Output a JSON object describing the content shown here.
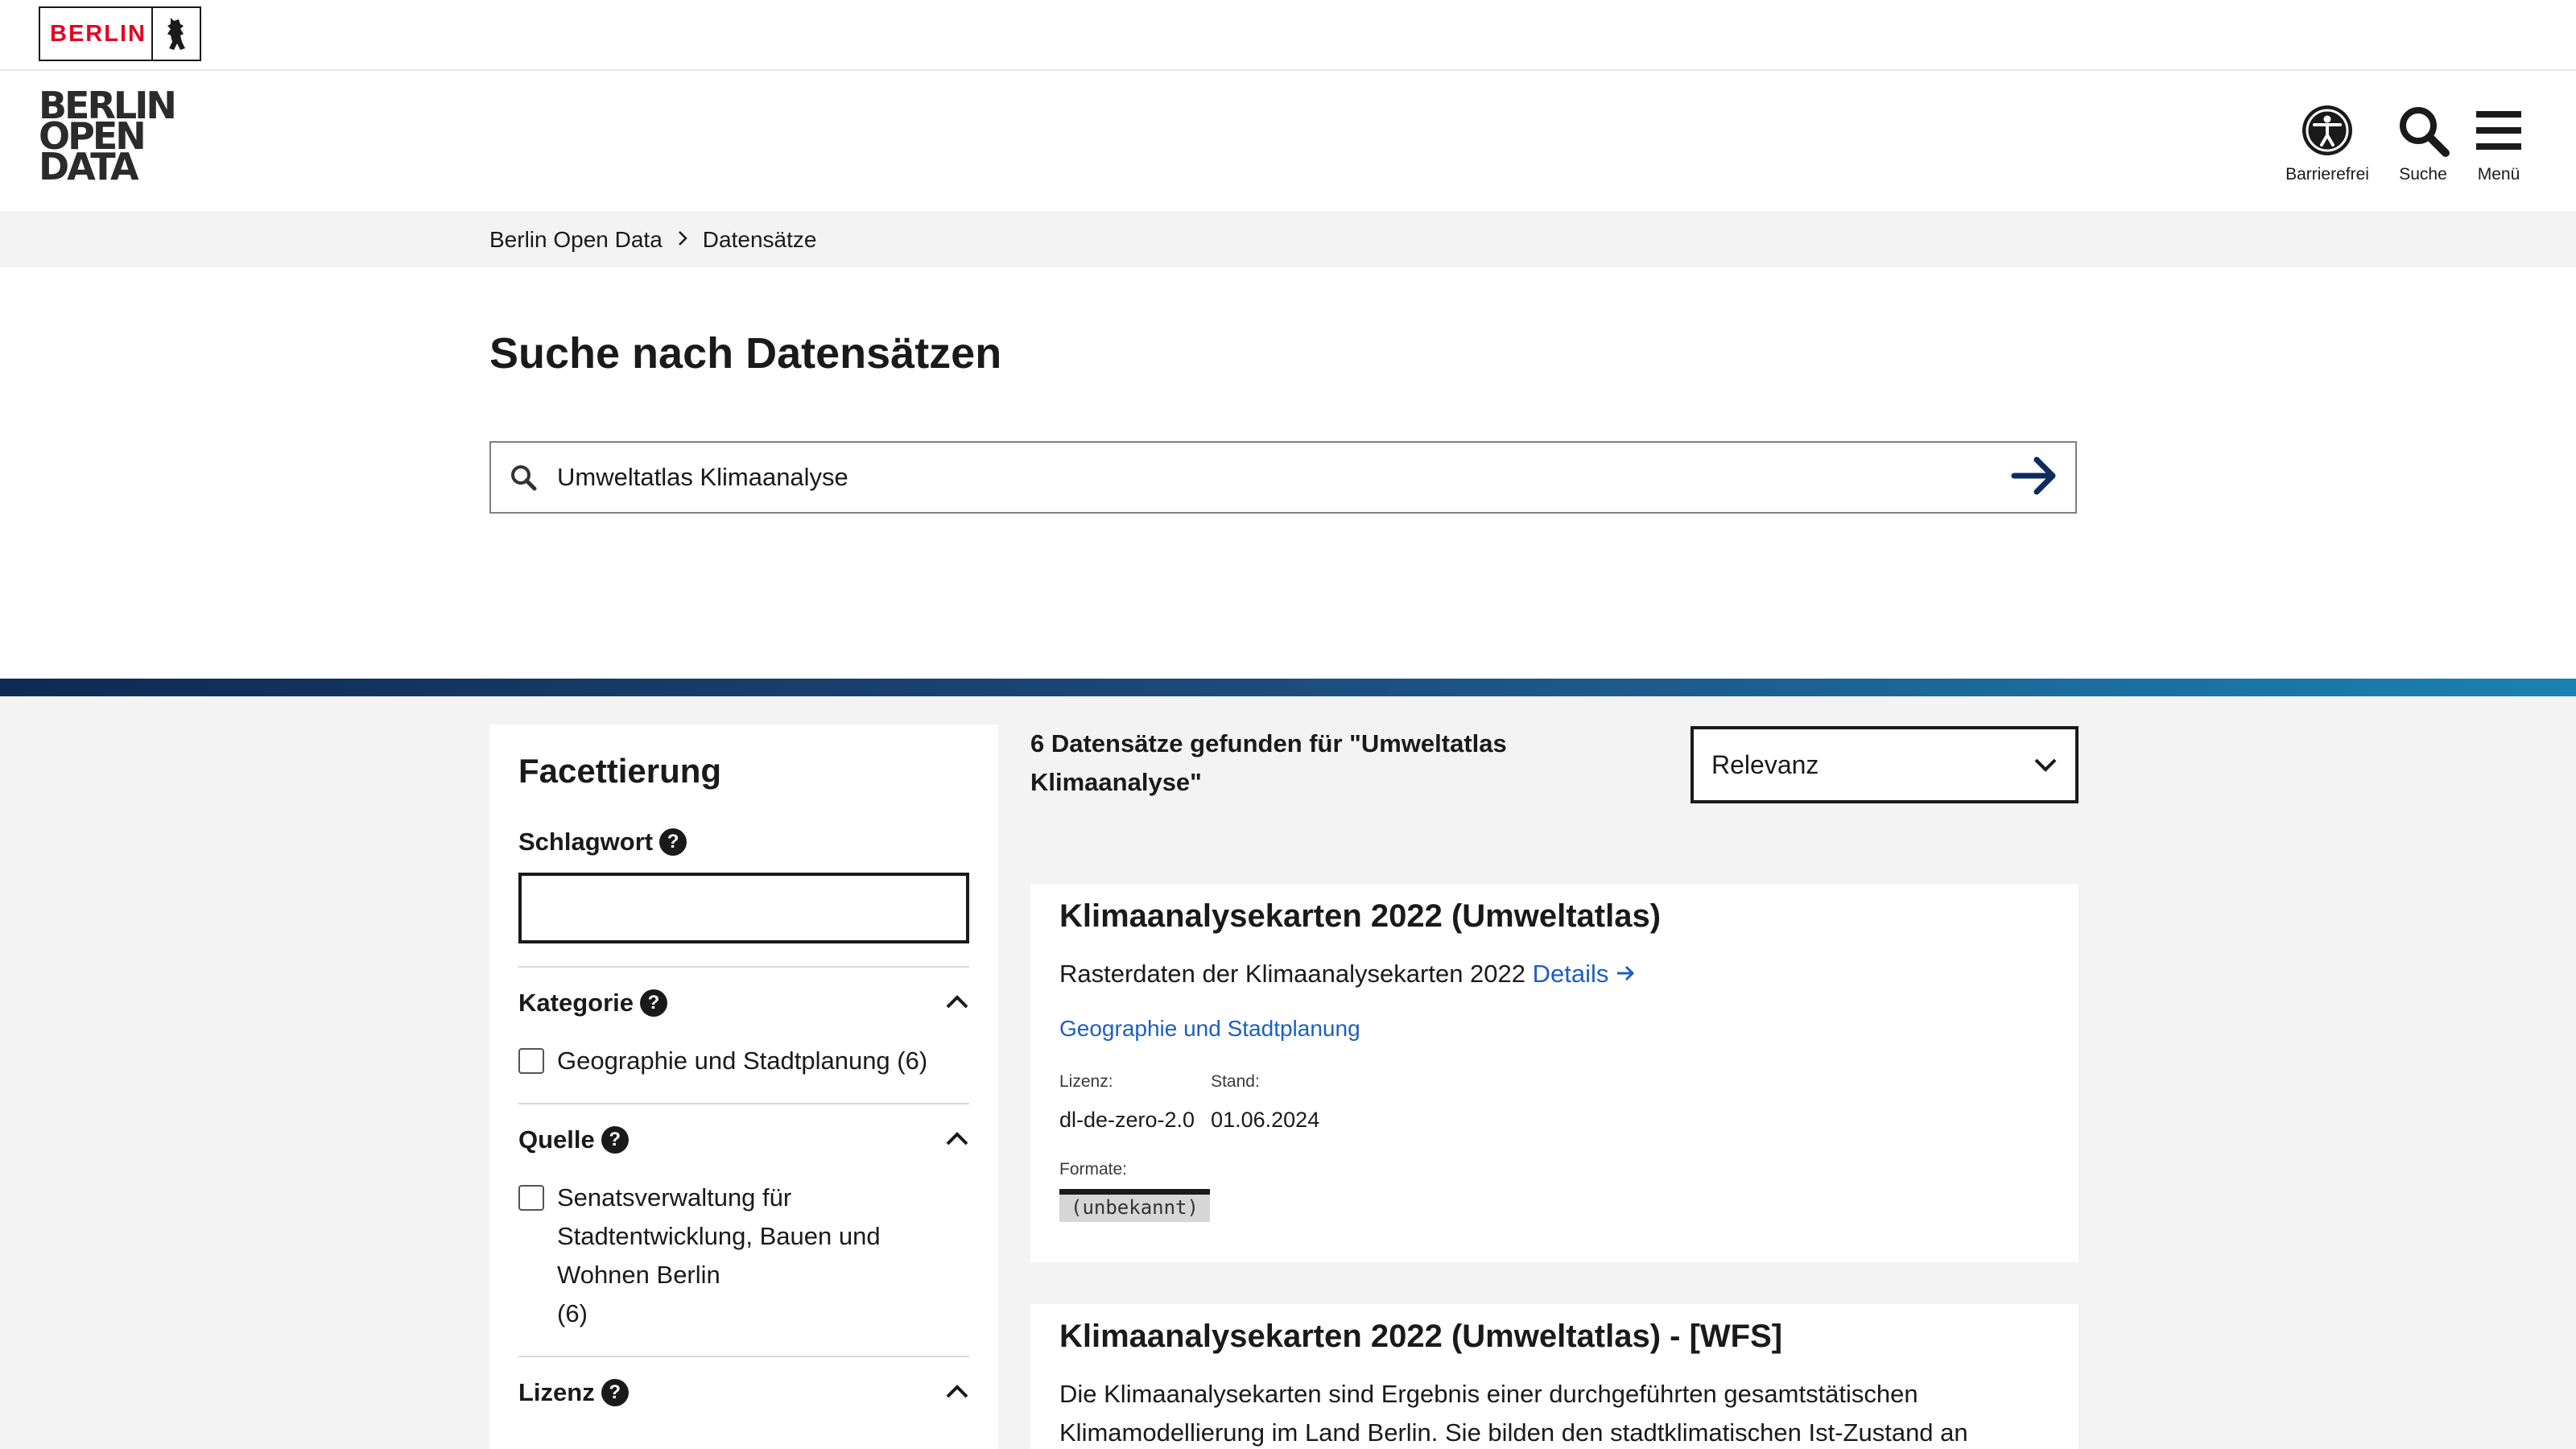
{
  "topbar": {
    "berlin_label": "BERLIN"
  },
  "header": {
    "logo_lines": [
      "BERLIN",
      "OPEN",
      "DATA"
    ],
    "accessibility_label": "Barrierefrei",
    "search_label": "Suche",
    "menu_label": "Menü"
  },
  "breadcrumb": {
    "home": "Berlin Open Data",
    "current": "Datensätze"
  },
  "page_title": "Suche nach Datensätzen",
  "search": {
    "value": "Umweltatlas Klimaanalyse"
  },
  "facets": {
    "title": "Facettierung",
    "keyword_label": "Schlagwort",
    "kategorie": {
      "label": "Kategorie",
      "option": "Geographie und Stadtplanung (6)"
    },
    "quelle": {
      "label": "Quelle",
      "option_lines": [
        "Senatsverwaltung für",
        "Stadtentwicklung, Bauen und",
        "Wohnen Berlin",
        "(6)"
      ]
    },
    "lizenz": {
      "label": "Lizenz"
    }
  },
  "results": {
    "count_lines": [
      "6 Datensätze gefunden für \"Umweltatlas",
      "Klimaanalyse\""
    ],
    "sort_value": "Relevanz",
    "items": [
      {
        "title": "Klimaanalysekarten 2022 (Umweltatlas)",
        "description": "Rasterdaten der Klimaanalysekarten 2022",
        "details_label": "Details",
        "category": "Geographie und Stadtplanung",
        "license_label": "Lizenz:",
        "license": "dl-de-zero-2.0",
        "date_label": "Stand:",
        "date": "01.06.2024",
        "formats_label": "Formate:",
        "format": "(unbekannt)"
      },
      {
        "title": "Klimaanalysekarten 2022 (Umweltatlas) - [WFS]",
        "description_lines": [
          "Die Klimaanalysekarten sind Ergebnis einer durchgeführten gesamtstätischen",
          "Klimamodellierung im Land Berlin. Sie bilden den stadtklimatischen Ist-Zustand an"
        ]
      }
    ]
  },
  "colors": {
    "berlin_red": "#e40422",
    "link_blue": "#1d5fbf",
    "arrow_navy": "#0d2b5c"
  }
}
